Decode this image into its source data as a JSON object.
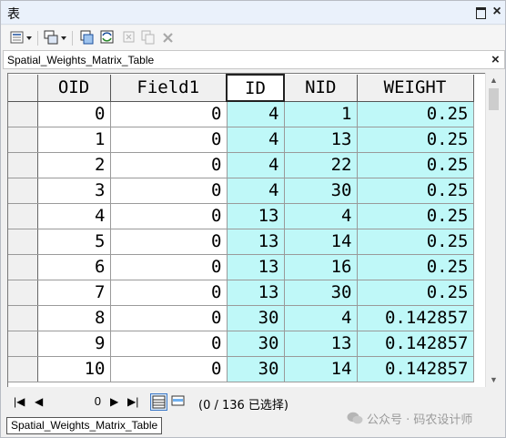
{
  "window": {
    "title": "表"
  },
  "tab": {
    "label": "Spatial_Weights_Matrix_Table"
  },
  "table": {
    "columns": [
      "OID",
      "Field1",
      "ID",
      "NID",
      "WEIGHT"
    ],
    "rows": [
      [
        "0",
        "0",
        "4",
        "1",
        "0.25"
      ],
      [
        "1",
        "0",
        "4",
        "13",
        "0.25"
      ],
      [
        "2",
        "0",
        "4",
        "22",
        "0.25"
      ],
      [
        "3",
        "0",
        "4",
        "30",
        "0.25"
      ],
      [
        "4",
        "0",
        "13",
        "4",
        "0.25"
      ],
      [
        "5",
        "0",
        "13",
        "14",
        "0.25"
      ],
      [
        "6",
        "0",
        "13",
        "16",
        "0.25"
      ],
      [
        "7",
        "0",
        "13",
        "30",
        "0.25"
      ],
      [
        "8",
        "0",
        "30",
        "4",
        "0.142857"
      ],
      [
        "9",
        "0",
        "30",
        "13",
        "0.142857"
      ],
      [
        "10",
        "0",
        "30",
        "14",
        "0.142857"
      ]
    ],
    "highlight_color": "#bff8f8"
  },
  "nav": {
    "current_record": "0",
    "status": "(0 / 136 已选择)"
  },
  "bottom_tab": {
    "label": "Spatial_Weights_Matrix_Table"
  },
  "watermark": {
    "text": "公众号 · 码农设计师"
  }
}
